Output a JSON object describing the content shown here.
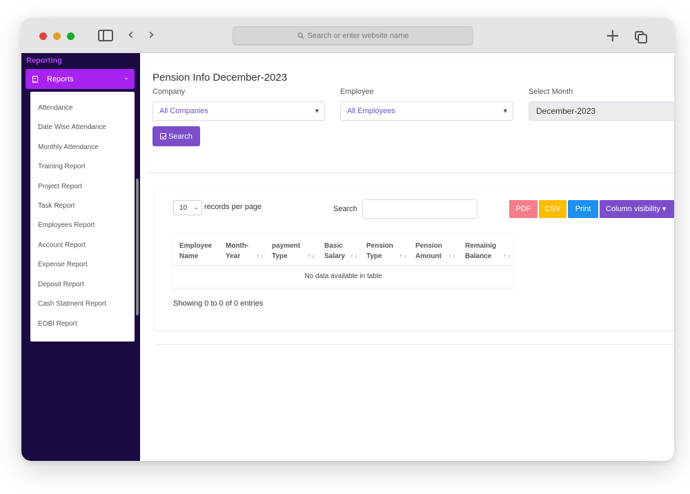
{
  "browser": {
    "url_placeholder": "Search or enter website name"
  },
  "sidebar": {
    "heading": "Reporting",
    "active_menu": "Reports",
    "items": [
      "Attendance",
      "Date Wise Attendance",
      "Monthly Attendance",
      "Training Report",
      "Project Report",
      "Task Report",
      "Employees Report",
      "Account Report",
      "Expense Report",
      "Deposit Report",
      "Cash Statment Report",
      "EOBI Report"
    ]
  },
  "filters": {
    "title": "Pension Info December-2023",
    "company_label": "Company",
    "company_value": "All Companies",
    "employee_label": "Employee",
    "employee_value": "All Employees",
    "month_label": "Select Month",
    "month_value": "December-2023",
    "search_button": "Search"
  },
  "table": {
    "page_length": "10",
    "records_per_page": "records per page",
    "search_label": "Search",
    "buttons": {
      "pdf": "PDF",
      "csv": "CSV",
      "print": "Print",
      "column_visibility": "Column visibility"
    },
    "columns": [
      [
        "Employee",
        "Name"
      ],
      [
        "Month-",
        "Year"
      ],
      [
        "payment",
        "Type"
      ],
      [
        "Basic",
        "Salary"
      ],
      [
        "Pension",
        "Type"
      ],
      [
        "Pension",
        "Amount"
      ],
      [
        "Remainig",
        "Balance"
      ]
    ],
    "empty_message": "No data available in table",
    "info": "Showing 0 to 0 of 0 entries"
  },
  "colors": {
    "sidebar_bg": "#1b0b44",
    "accent_purple": "#a623f0",
    "button_purple": "#7c4dcb",
    "pdf": "#f57c8a",
    "csv": "#fbbc05",
    "print": "#1e90f0"
  }
}
